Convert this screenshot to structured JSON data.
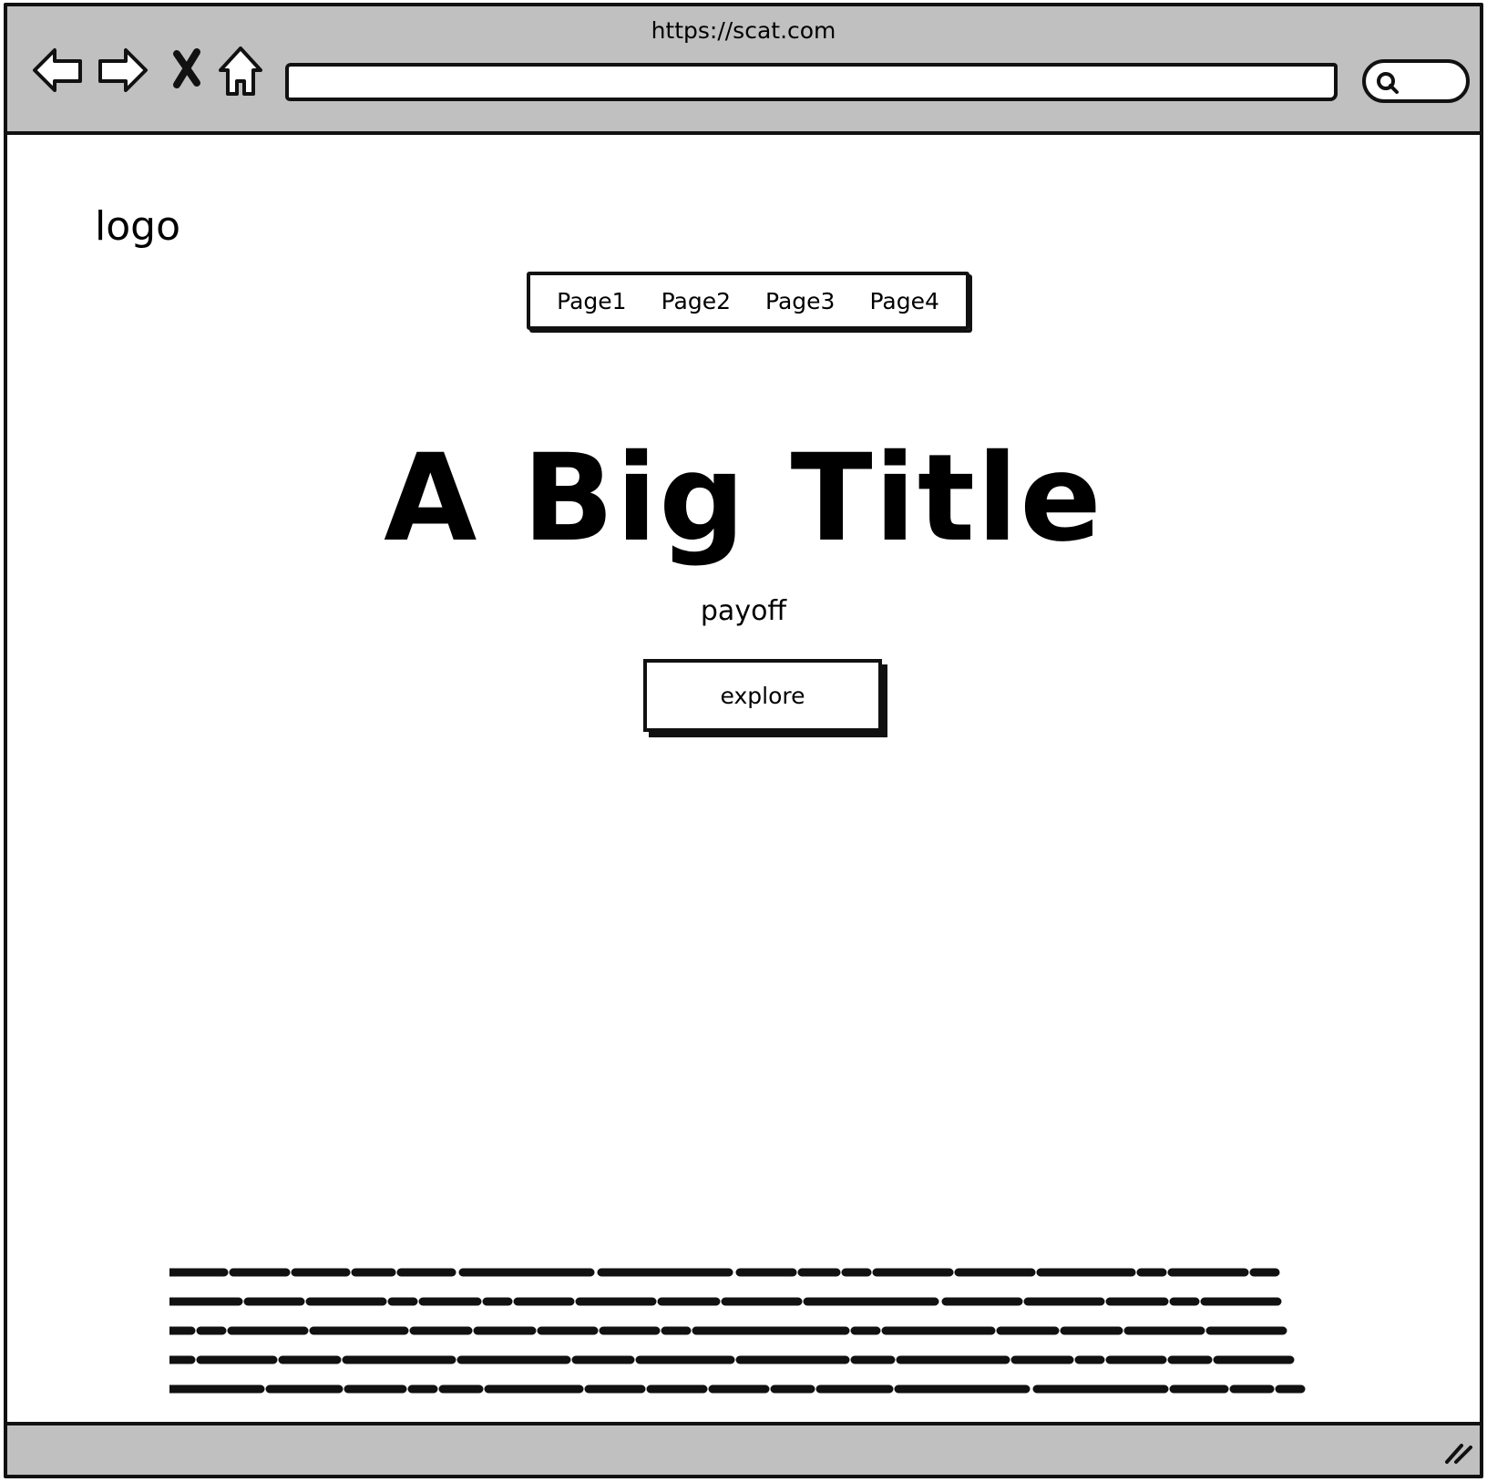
{
  "browser": {
    "url": "https://scat.com",
    "address_value": "",
    "icons": [
      "back-arrow-icon",
      "forward-arrow-icon",
      "stop-icon",
      "home-icon",
      "search-icon",
      "resize-grip-icon"
    ]
  },
  "page": {
    "logo": "logo",
    "nav": [
      "Page1",
      "Page2",
      "Page3",
      "Page4"
    ],
    "title": "A Big Title",
    "payoff": "payoff",
    "cta": "explore"
  }
}
